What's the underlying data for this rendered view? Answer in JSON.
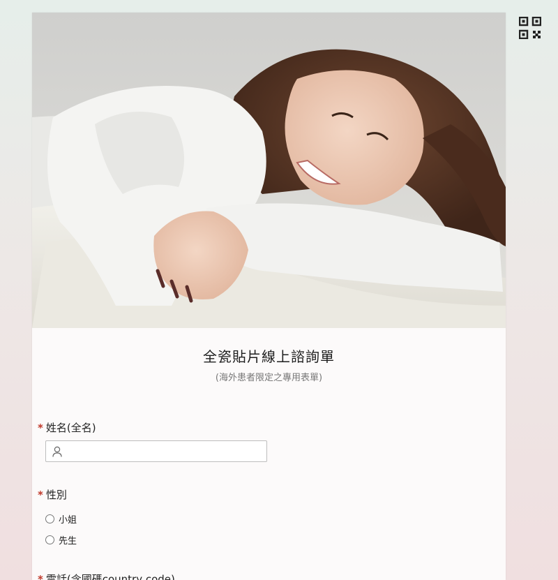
{
  "form": {
    "title": "全瓷貼片線上諮詢單",
    "subtitle": "(海外患者限定之專用表單)"
  },
  "fields": {
    "name": {
      "required_mark": "*",
      "label": "姓名(全名)",
      "value": "",
      "icon": "person-icon"
    },
    "gender": {
      "required_mark": "*",
      "label": "性別",
      "options": [
        "小姐",
        "先生"
      ],
      "selected": null
    },
    "phone": {
      "required_mark": "*",
      "label": "電話(含國碼country code)"
    }
  },
  "icons": {
    "qr": "qr-code-icon",
    "hero": "hero-photo"
  },
  "colors": {
    "required": "#c0392b",
    "card": "#fcfafa"
  }
}
